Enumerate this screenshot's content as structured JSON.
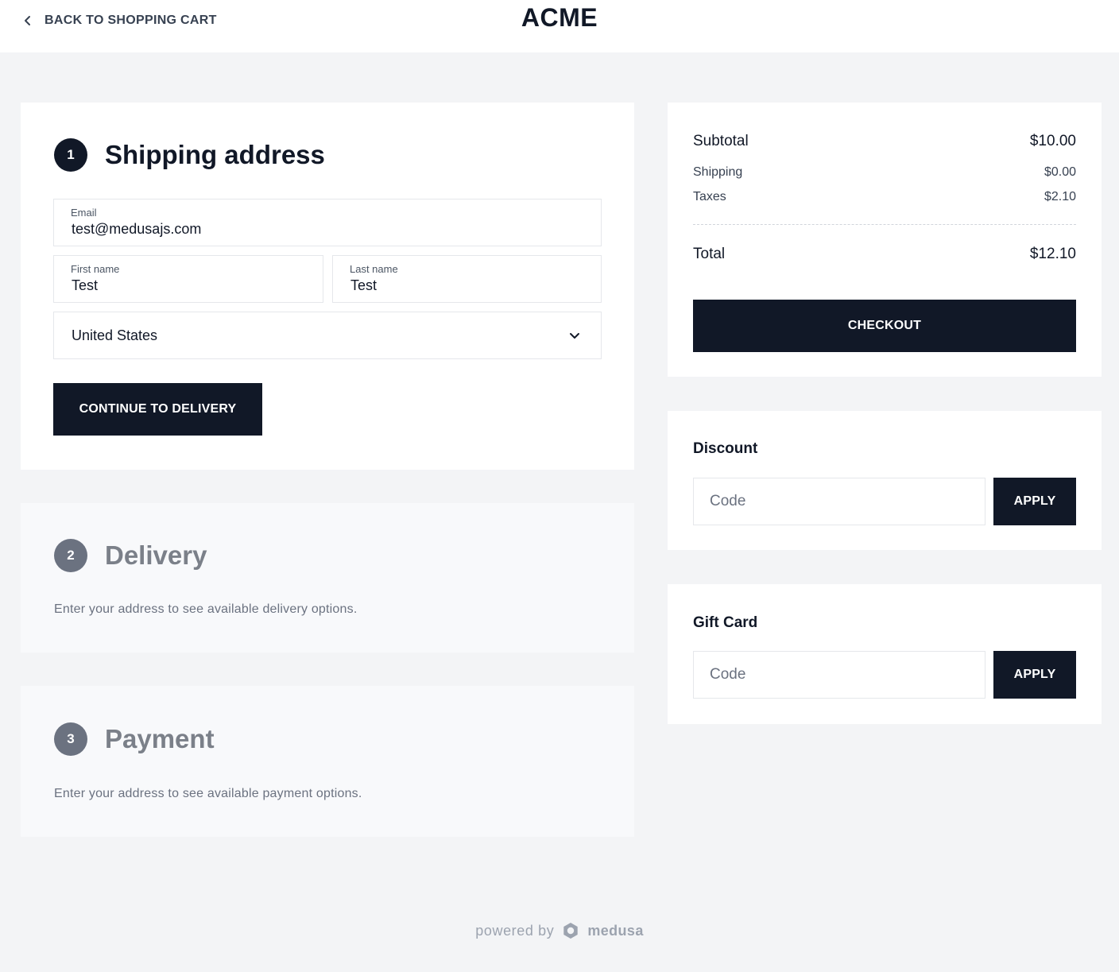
{
  "header": {
    "back_label": "BACK TO SHOPPING CART",
    "logo": "ACME"
  },
  "shipping": {
    "step": "1",
    "title": "Shipping address",
    "email": {
      "label": "Email",
      "value": "test@medusajs.com"
    },
    "first_name": {
      "label": "First name",
      "value": "Test"
    },
    "last_name": {
      "label": "Last name",
      "value": "Test"
    },
    "country": {
      "value": "United States"
    },
    "continue_label": "CONTINUE TO DELIVERY"
  },
  "delivery": {
    "step": "2",
    "title": "Delivery",
    "hint": "Enter your address to see available delivery options."
  },
  "payment": {
    "step": "3",
    "title": "Payment",
    "hint": "Enter your address to see available payment options."
  },
  "summary": {
    "subtotal_label": "Subtotal",
    "subtotal": "$10.00",
    "shipping_label": "Shipping",
    "shipping": "$0.00",
    "taxes_label": "Taxes",
    "taxes": "$2.10",
    "total_label": "Total",
    "total": "$12.10",
    "checkout_label": "CHECKOUT"
  },
  "discount": {
    "title": "Discount",
    "placeholder": "Code",
    "apply_label": "APPLY"
  },
  "gift_card": {
    "title": "Gift Card",
    "placeholder": "Code",
    "apply_label": "APPLY"
  },
  "footer": {
    "powered_by": "powered by",
    "brand": "medusa"
  },
  "colors": {
    "primary": "#111827",
    "background": "#f3f4f6",
    "muted_card": "#f8f9fb",
    "muted_text": "#6b7280"
  }
}
